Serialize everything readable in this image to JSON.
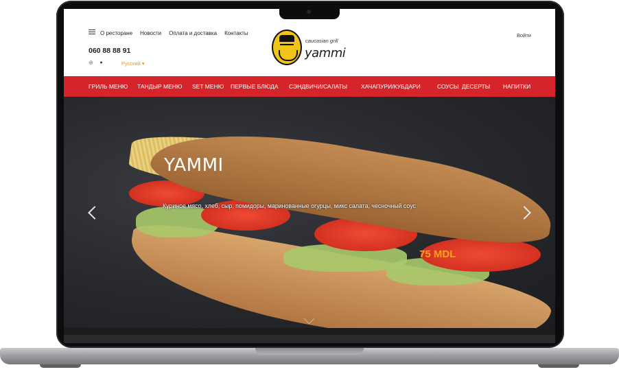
{
  "header": {
    "nav": [
      {
        "label": "О ресторане"
      },
      {
        "label": "Новости"
      },
      {
        "label": "Оплата и доставка"
      },
      {
        "label": "Контакты"
      }
    ],
    "phone": "060 88 88 91",
    "language": "Русский ▾",
    "login": "Войти",
    "logo": {
      "sub": "caucasian grill",
      "name": "yammi"
    },
    "social_icons": [
      "instagram-icon",
      "facebook-icon"
    ]
  },
  "categories": [
    {
      "label": "ГРИЛЬ МЕНЮ"
    },
    {
      "label": "ТАНДЫР МЕНЮ"
    },
    {
      "label": "SET МЕНЮ"
    },
    {
      "label": "ПЕРВЫЕ БЛЮДА"
    },
    {
      "label": "СЭНДВИЧИ/САЛАТЫ"
    },
    {
      "label": "ХАЧАПУРИ/КУБДАРИ"
    },
    {
      "label": "СОУСЫ"
    },
    {
      "label": "ДЕСЕРТЫ"
    },
    {
      "label": "НАПИТКИ"
    }
  ],
  "hero": {
    "title": "YAMMI",
    "description": "Куриное мясо, хлеб, сыр, помидоры, маринованные огурцы, микс салата, чесночный соус",
    "price": "75 MDL"
  },
  "colors": {
    "accent_red": "#d6252a",
    "price_orange": "#f6a31d",
    "lang_orange": "#e0962a"
  }
}
